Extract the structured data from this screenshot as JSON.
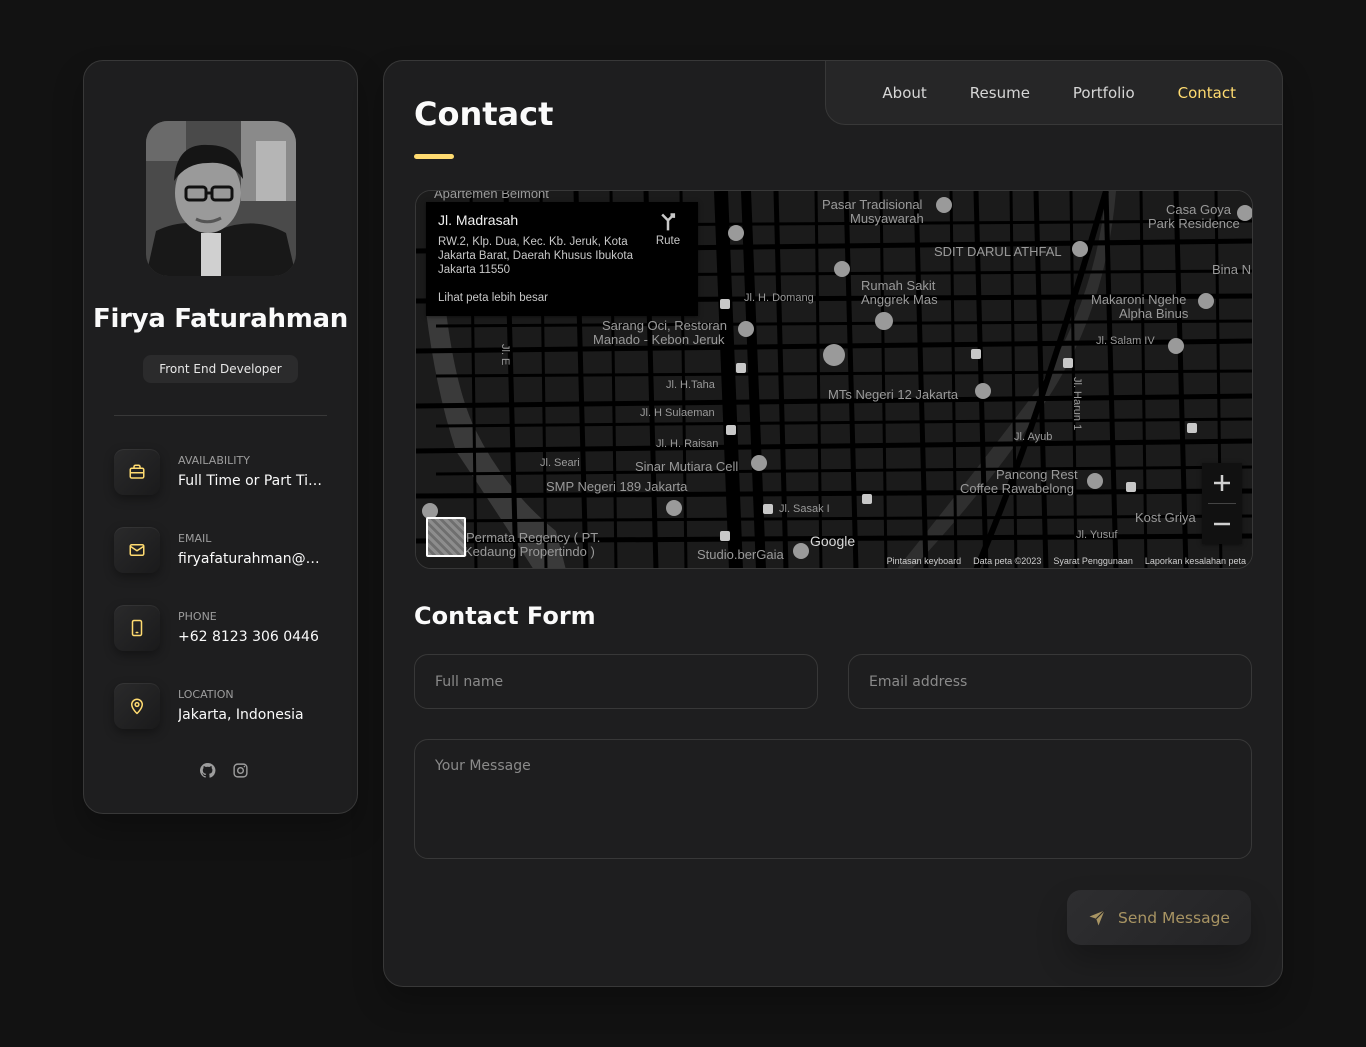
{
  "sidebar": {
    "name": "Firya Faturahman",
    "role": "Front End Developer",
    "contacts": [
      {
        "label": "Availability",
        "value": "Full Time or Part Time",
        "icon": "briefcase-icon"
      },
      {
        "label": "Email",
        "value": "firyafaturahman@gmail.com",
        "icon": "mail-icon"
      },
      {
        "label": "Phone",
        "value": "+62 8123 306 0446",
        "icon": "phone-icon"
      },
      {
        "label": "Location",
        "value": "Jakarta, Indonesia",
        "icon": "location-pin-icon"
      }
    ],
    "socials": [
      "github-icon",
      "instagram-icon"
    ]
  },
  "nav": {
    "items": [
      "About",
      "Resume",
      "Portfolio",
      "Contact"
    ],
    "active": "Contact"
  },
  "page": {
    "title": "Contact",
    "form_title": "Contact Form"
  },
  "map": {
    "place_title": "Jl. Madrasah",
    "place_address": "RW.2, Klp. Dua, Kec. Kb. Jeruk, Kota Jakarta Barat, Daerah Khusus Ibukota Jakarta 11550",
    "view_larger": "Lihat peta lebih besar",
    "route": "Rute",
    "footer": [
      "Pintasan keyboard",
      "Data peta ©2023",
      "Syarat Penggunaan",
      "Laporkan kesalahan peta"
    ],
    "google": "Google",
    "labels": [
      "Apartemen Belmont",
      "Pasar Tradisional",
      "Musyawarah",
      "Casa Goya",
      "Park Residence",
      "SDIT DARUL ATHFAL",
      "Bina N",
      "Rumah Sakit",
      "Anggrek Mas",
      "Jl. H. Domang",
      "Makaroni Ngehe",
      "Alpha Binus",
      "Sarang Oci, Restoran",
      "Manado - Kebon Jeruk",
      "Jl. Salam IV",
      "Jl. H.Taha",
      "MTs Negeri 12 Jakarta",
      "Jl. H Sulaeman",
      "Jl. Ayub",
      "Jl. H. Raisan",
      "Jl. Seari",
      "Sinar Mutiara Cell",
      "Pancong Rest",
      "Coffee Rawabelong",
      "SMP Negeri 189 Jakarta",
      "Jl. Sasak I",
      "Kost Griya",
      "Permata Regency ( PT.",
      "Kedaung Propertindo )",
      "Jl. Yusuf",
      "Studio.berGaia",
      "Jl. Harun 1",
      "Jl. E"
    ],
    "colors": {
      "bg": "#1b1b1b",
      "road": "#000000",
      "water": "#3a3a3a",
      "label": "#9a9a9a"
    }
  },
  "form": {
    "fullname_placeholder": "Full name",
    "email_placeholder": "Email address",
    "message_placeholder": "Your Message",
    "submit_label": "Send Message"
  },
  "colors": {
    "accent": "#ffdb70",
    "bg": "#121212",
    "card": "#1e1e1f",
    "border": "#383838"
  }
}
